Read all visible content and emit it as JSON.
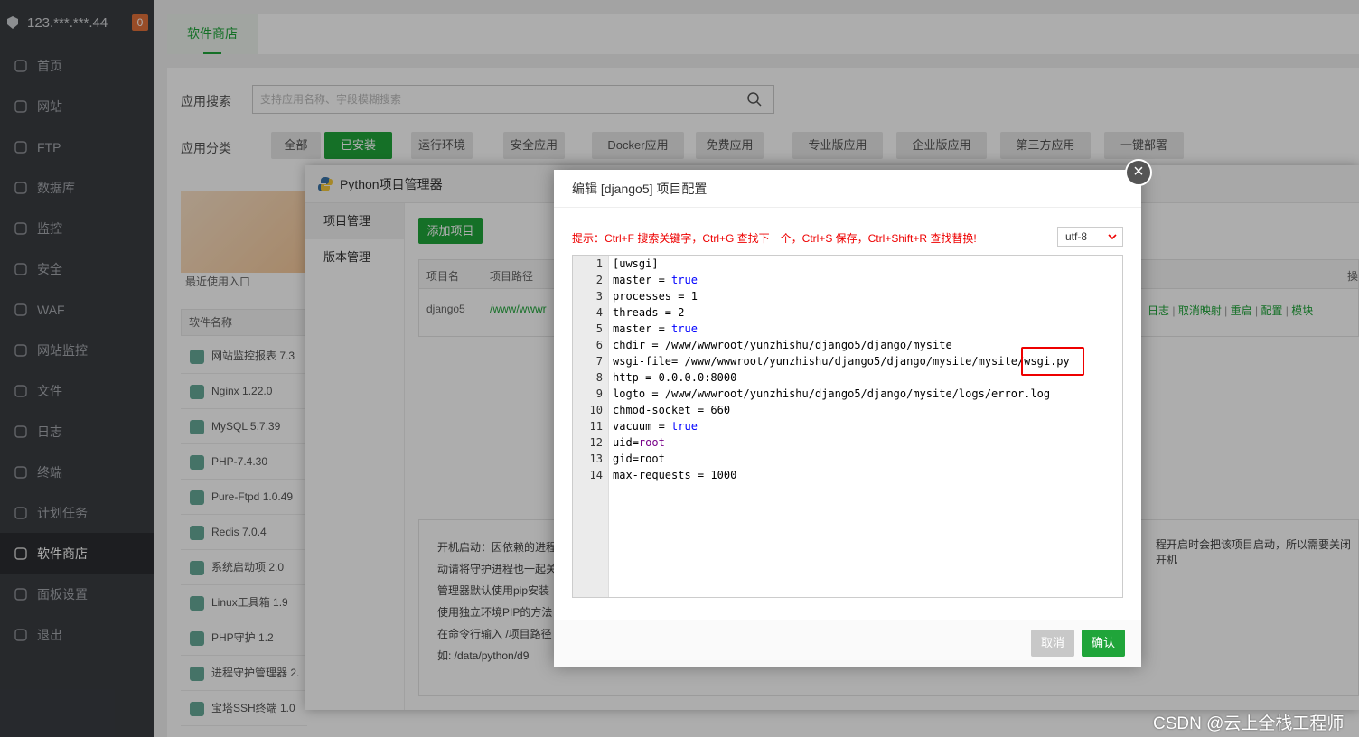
{
  "sidebar": {
    "server": "123.***.***.44",
    "badge": "0",
    "items": [
      {
        "label": "首页",
        "icon": "home-icon"
      },
      {
        "label": "网站",
        "icon": "globe-icon"
      },
      {
        "label": "FTP",
        "icon": "ftp-icon"
      },
      {
        "label": "数据库",
        "icon": "database-icon"
      },
      {
        "label": "监控",
        "icon": "monitor-icon"
      },
      {
        "label": "安全",
        "icon": "shield-icon"
      },
      {
        "label": "WAF",
        "icon": "waf-icon"
      },
      {
        "label": "网站监控",
        "icon": "chart-icon"
      },
      {
        "label": "文件",
        "icon": "folder-icon"
      },
      {
        "label": "日志",
        "icon": "log-icon"
      },
      {
        "label": "终端",
        "icon": "terminal-icon"
      },
      {
        "label": "计划任务",
        "icon": "calendar-icon"
      },
      {
        "label": "软件商店",
        "icon": "store-icon"
      },
      {
        "label": "面板设置",
        "icon": "settings-icon"
      },
      {
        "label": "退出",
        "icon": "logout-icon"
      }
    ],
    "active_index": 12
  },
  "store": {
    "tab": "软件商店",
    "search_label": "应用搜索",
    "search_placeholder": "支持应用名称、字段模糊搜索",
    "category_label": "应用分类",
    "categories": [
      "全部",
      "已安装",
      "运行环境",
      "安全应用",
      "Docker应用",
      "免费应用",
      "专业版应用",
      "企业版应用",
      "第三方应用",
      "一键部署"
    ],
    "active_category": 1,
    "recent_label": "最近使用入口",
    "software_header": "软件名称",
    "software": [
      "网站监控报表 7.3",
      "Nginx 1.22.0",
      "MySQL 5.7.39",
      "PHP-7.4.30",
      "Pure-Ftpd 1.0.49",
      "Redis 7.0.4",
      "系统启动项 2.0",
      "Linux工具箱 1.9",
      "PHP守护 1.2",
      "进程守护管理器 2.",
      "宝塔SSH终端 1.0"
    ]
  },
  "python_manager": {
    "title": "Python项目管理器",
    "menu": [
      "项目管理",
      "版本管理"
    ],
    "add_button": "添加项目",
    "columns": {
      "name": "项目名",
      "path": "项目路径",
      "ops": "操"
    },
    "row": {
      "name": "django5",
      "path": "/www/wwwr"
    },
    "row_actions": [
      "日志",
      "取消映射",
      "重启",
      "配置",
      "模块"
    ],
    "notes": [
      "开机启动：因依赖的进程",
      "动请将守护进程也一起关",
      "管理器默认使用pip安装",
      "使用独立环境PIP的方法",
      "在命令行输入  /项目路径",
      "如:   /data/python/d9"
    ],
    "notes_right": "程开启时会把该项目启动，所以需要关闭开机"
  },
  "editor": {
    "title": "编辑 [django5] 项目配置",
    "tip": "提示：Ctrl+F 搜索关键字，Ctrl+G 查找下一个，Ctrl+S 保存，Ctrl+Shift+R 查找替换!",
    "encoding": "utf-8",
    "lines": [
      {
        "n": "1",
        "k": "[uwsgi]",
        "op": "",
        "v": "",
        "t": "plain"
      },
      {
        "n": "2",
        "k": "master",
        "op": " = ",
        "v": "true",
        "t": "bool"
      },
      {
        "n": "3",
        "k": "processes",
        "op": " = ",
        "v": "1",
        "t": "plain"
      },
      {
        "n": "4",
        "k": "threads",
        "op": " = ",
        "v": "2",
        "t": "plain"
      },
      {
        "n": "5",
        "k": "master",
        "op": " = ",
        "v": "true",
        "t": "bool"
      },
      {
        "n": "6",
        "k": "chdir",
        "op": " = ",
        "v": "/www/wwwroot/yunzhishu/django5/django/mysite",
        "t": "plain"
      },
      {
        "n": "7",
        "k": "wsgi-file",
        "op": "= ",
        "v": "/www/wwwroot/yunzhishu/django5/django/mysite/mysite/wsgi.py",
        "t": "plain"
      },
      {
        "n": "8",
        "k": "http",
        "op": " = ",
        "v": "0.0.0.0:8000",
        "t": "plain"
      },
      {
        "n": "9",
        "k": "logto",
        "op": " = ",
        "v": "/www/wwwroot/yunzhishu/django5/django/mysite/logs/error.log",
        "t": "plain"
      },
      {
        "n": "10",
        "k": "chmod-socket",
        "op": " = ",
        "v": "660",
        "t": "plain"
      },
      {
        "n": "11",
        "k": "vacuum",
        "op": " = ",
        "v": "true",
        "t": "bool"
      },
      {
        "n": "12",
        "k": "uid",
        "op": "=",
        "v": "root",
        "t": "kw"
      },
      {
        "n": "13",
        "k": "gid",
        "op": "=",
        "v": "root",
        "t": "plain"
      },
      {
        "n": "14",
        "k": "max-requests",
        "op": " = ",
        "v": "1000",
        "t": "plain"
      }
    ],
    "cancel": "取消",
    "confirm": "确认"
  },
  "watermark": "CSDN @云上全栈工程师",
  "colors": {
    "accent": "#20a53a",
    "sidebar": "#3a3d42",
    "highlight": "#ee0000"
  }
}
